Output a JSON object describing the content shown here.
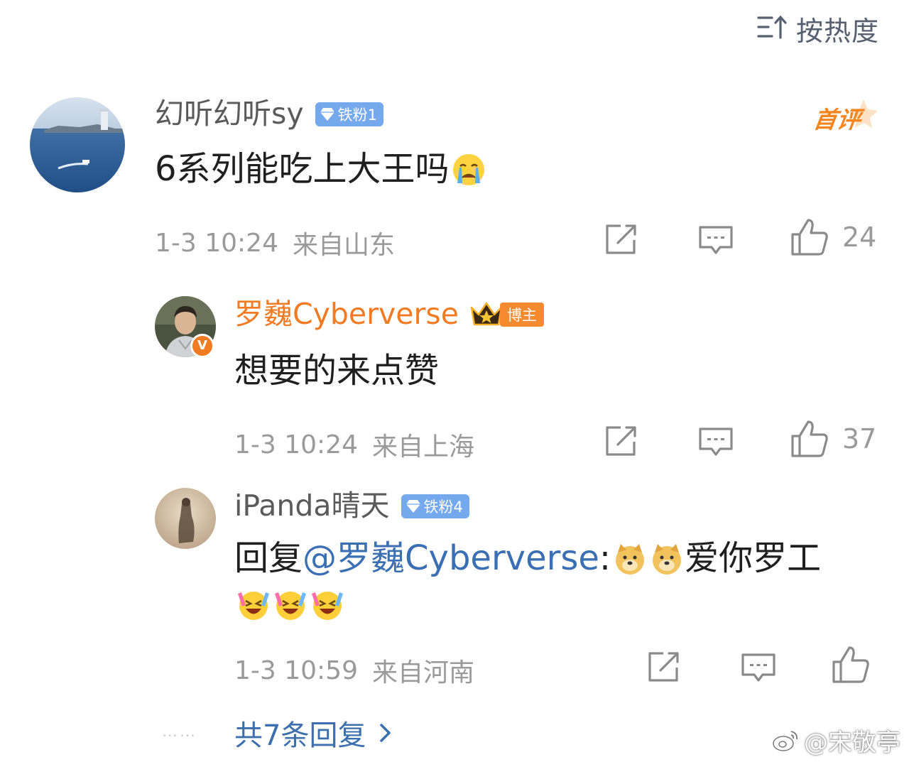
{
  "sort": {
    "label": "按热度",
    "icon": "sort-icon"
  },
  "comments": [
    {
      "username": "幻听幻听sy",
      "badge": "铁粉1",
      "stamp": "首评",
      "text": "6系列能吃上大王吗",
      "emoji": "crying-face-emoji",
      "date": "1-3 10:24",
      "location": "来自山东",
      "likes": "24"
    },
    {
      "username": "罗巍Cyberverse",
      "badge": "博主",
      "verified": "V",
      "text": "想要的来点赞",
      "date": "1-3 10:24",
      "location": "来自上海",
      "likes": "37"
    },
    {
      "username": "iPanda晴天",
      "badge": "铁粉4",
      "text_prefix": "回复",
      "mention": "@罗巍Cyberverse",
      "text_sep": ":",
      "text_suffix": "爱你罗工",
      "emojis_inline": [
        "doge-emoji",
        "doge-emoji"
      ],
      "emojis_line2": [
        "laughing-crying-emoji",
        "laughing-crying-emoji",
        "laughing-crying-emoji"
      ],
      "date": "1-3 10:59",
      "location": "来自河南",
      "likes": ""
    }
  ],
  "footer": {
    "dots": "……",
    "more_replies": "共7条回复",
    "watermark": "@宋敬亭"
  },
  "colors": {
    "mention": "#3a6fb3",
    "blogger_name": "#f07b22",
    "fan_badge": "#74a9ee",
    "blogger_badge": "#f58a2e",
    "meta": "#9a9a9a"
  }
}
